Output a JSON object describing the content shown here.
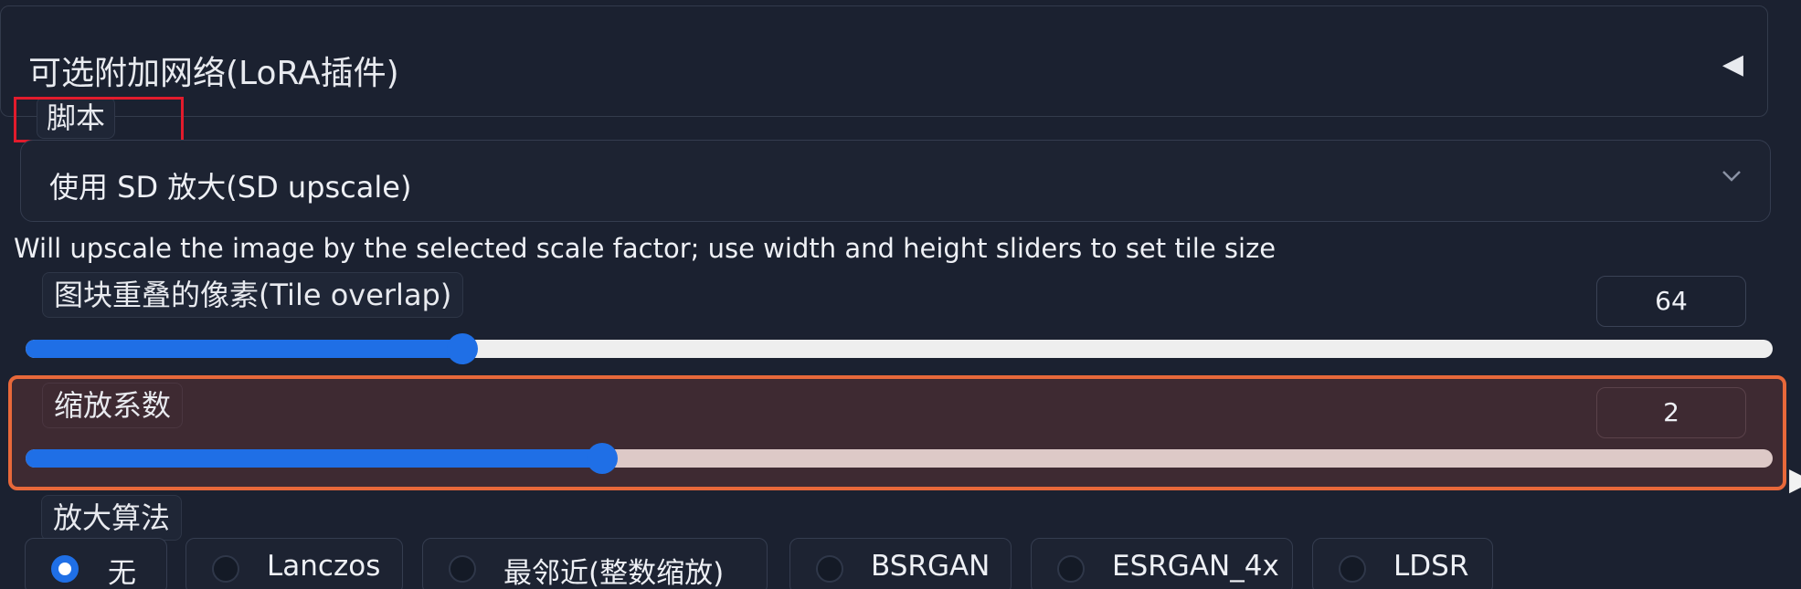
{
  "accordion": {
    "title": "可选附加网络(LoRA插件)",
    "arrow": "◀"
  },
  "script": {
    "label": "脚本",
    "selected": "使用 SD 放大(SD upscale)",
    "description": "Will upscale the image by the selected scale factor; use width and height sliders to set tile size"
  },
  "tile_overlap": {
    "label": "图块重叠的像素(Tile overlap)",
    "value": "64",
    "fill_fraction": 0.25
  },
  "scale_factor": {
    "label": "缩放系数",
    "value": "2",
    "fill_fraction": 0.33
  },
  "upscaler": {
    "label": "放大算法",
    "options": [
      {
        "label": "无",
        "checked": true
      },
      {
        "label": "Lanczos",
        "checked": false
      },
      {
        "label": "最邻近(整数缩放)",
        "checked": false
      },
      {
        "label": "BSRGAN",
        "checked": false
      },
      {
        "label": "ESRGAN_4x",
        "checked": false
      },
      {
        "label": "LDSR",
        "checked": false
      }
    ]
  },
  "colors": {
    "accent": "#1f6fe6",
    "highlight_red": "#e21b2c",
    "highlight_orange": "#e8683a",
    "background": "#1b2130"
  }
}
